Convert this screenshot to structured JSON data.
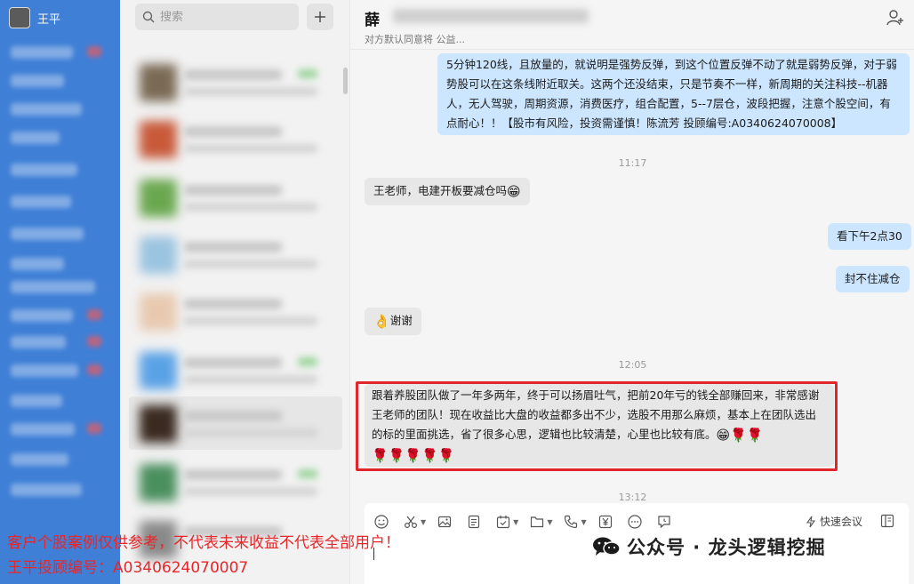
{
  "user": {
    "name": "王平"
  },
  "search": {
    "placeholder": "搜索"
  },
  "chat": {
    "contact_name": "薛",
    "contact_status": "对方默认同意将 公益...",
    "messages": [
      {
        "type": "out",
        "text": "5分钟120线，且放量的，就说明是强势反弹，到这个位置反弹不动了就是弱势反弹，对于弱势股可以在这条线附近取关。这两个还没结束，只是节奏不一样，新周期的关注科技--机器人，无人驾驶，周期资源，消费医疗，组合配置，5--7层仓，波段把握，注意个股空间，有点耐心！！【股市有风险，投资需谨慎！陈流芳 投顾编号:A0340624070008】"
      },
      {
        "type": "time",
        "text": "11:17"
      },
      {
        "type": "in",
        "text": "王老师，电建开板要减仓吗",
        "emoji": "😁"
      },
      {
        "type": "out",
        "text": "看下午2点30"
      },
      {
        "type": "out",
        "text": "封不住减仓"
      },
      {
        "type": "in",
        "text": "谢谢",
        "emoji": "👌"
      },
      {
        "type": "time",
        "text": "12:05"
      },
      {
        "type": "in",
        "text": "跟着养股团队做了一年多两年，终于可以扬眉吐气，把前20年亏的钱全部赚回来，非常感谢王老师的团队！现在收益比大盘的收益都多出不少，选股不用那么麻烦，基本上在团队选出的标的里面挑选，省了很多心思，逻辑也比较清楚，心里也比较有底。",
        "emoji_tail": "😁🌹🌹",
        "emoji_line": "🌹🌹🌹🌹🌹"
      },
      {
        "type": "time",
        "text": "13:12"
      }
    ]
  },
  "composer": {
    "meeting_label": "快速会议"
  },
  "overlays": {
    "disclaimer_line1": "客户个股案例仅供参考，不代表未来收益不代表全部用户！",
    "disclaimer_line2": "王平投顾编号：A0340624070007",
    "watermark": "公众号 · 龙头逻辑挖掘"
  },
  "colors": {
    "nav_bg": "#3f7fd6",
    "out_bubble": "#cde6ff",
    "in_bubble": "#e7e7e7",
    "highlight_border": "#e0262b",
    "disclaimer": "#e8262a"
  }
}
